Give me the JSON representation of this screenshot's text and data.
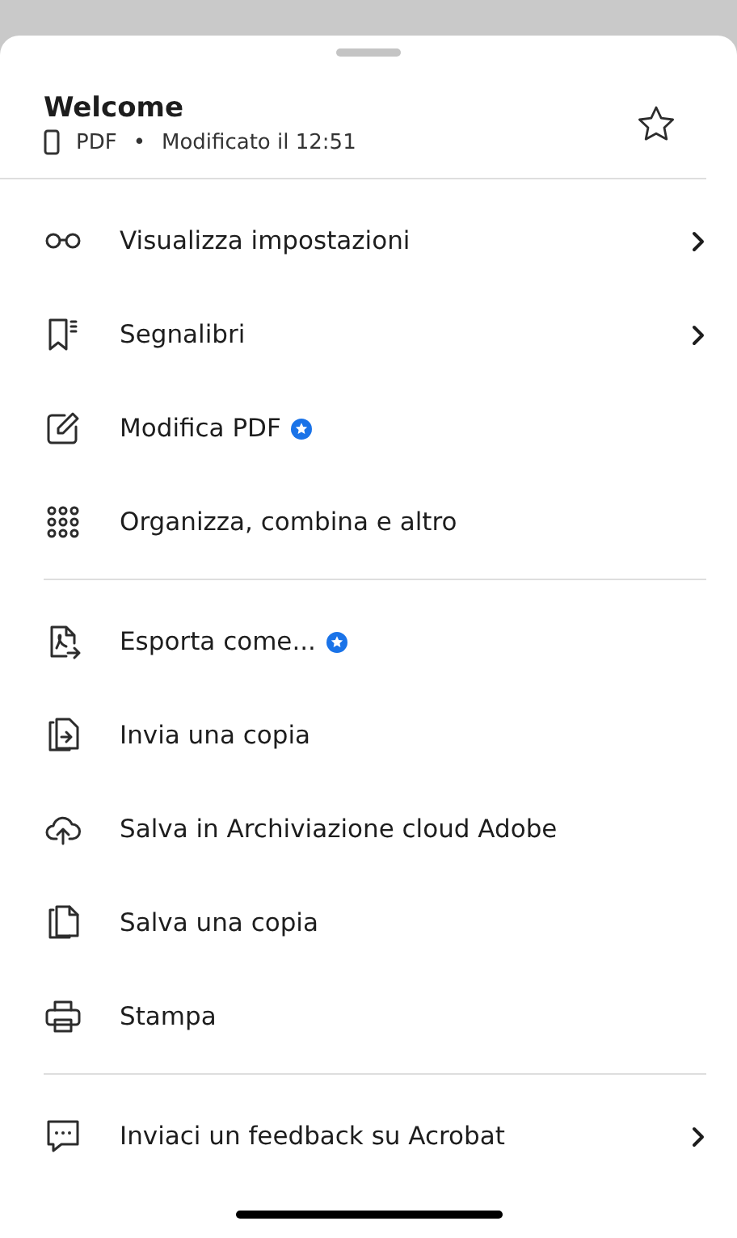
{
  "header": {
    "title": "Welcome",
    "file_type": "PDF",
    "separator": "•",
    "modified": "Modificato il 12:51",
    "favorite": false
  },
  "groups": [
    {
      "items": [
        {
          "label": "Visualizza impostazioni",
          "premium": false,
          "submenu": true
        },
        {
          "label": "Segnalibri",
          "premium": false,
          "submenu": true
        },
        {
          "label": "Modifica PDF",
          "premium": true,
          "submenu": false
        },
        {
          "label": "Organizza, combina e altro",
          "premium": false,
          "submenu": false
        }
      ]
    },
    {
      "items": [
        {
          "label": "Esporta come...",
          "premium": true,
          "submenu": false
        },
        {
          "label": "Invia una copia",
          "premium": false,
          "submenu": false
        },
        {
          "label": "Salva in Archiviazione cloud Adobe",
          "premium": false,
          "submenu": false
        },
        {
          "label": "Salva una copia",
          "premium": false,
          "submenu": false
        },
        {
          "label": "Stampa",
          "premium": false,
          "submenu": false
        }
      ]
    },
    {
      "items": [
        {
          "label": "Inviaci un feedback su Acrobat",
          "premium": false,
          "submenu": true
        }
      ]
    }
  ]
}
